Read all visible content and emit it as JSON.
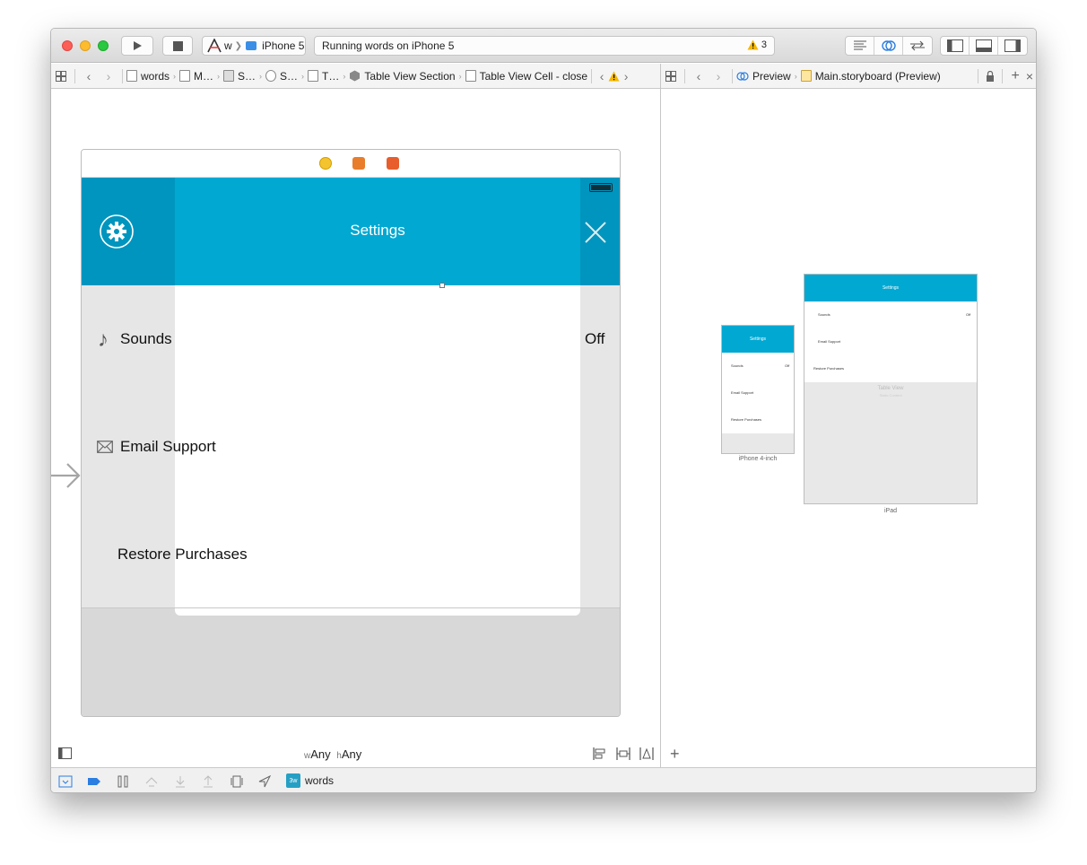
{
  "toolbar": {
    "scheme_target": "w",
    "device": "iPhone 5",
    "activity_text": "Running words on iPhone 5",
    "warning_count": "3"
  },
  "jumpbar_left": {
    "items": [
      "words",
      "M…",
      "S…",
      "S…",
      "T…",
      "Table View Section",
      "Table View Cell - close"
    ]
  },
  "jumpbar_right": {
    "mode": "Preview",
    "file": "Main.storyboard (Preview)"
  },
  "scene": {
    "nav_title": "Settings",
    "rows": {
      "sounds_label": "Sounds",
      "sounds_value": "Off",
      "email_label": "Email Support",
      "restore_label": "Restore Purchases"
    }
  },
  "editor_bottom": {
    "w_prefix": "w",
    "w_value": "Any",
    "h_prefix": "h",
    "h_value": "Any"
  },
  "preview": {
    "iphone_caption": "iPhone 4-inch",
    "ipad_caption": "iPad",
    "mini_title": "Settings",
    "mini_sounds": "Sounds",
    "mini_off": "Off",
    "mini_email": "Email Support",
    "mini_restore": "Restore Purchases",
    "table_view_label": "Table View",
    "table_view_sub": "Static Content"
  },
  "debug": {
    "target_name": "words",
    "app_icon_text": "3w"
  },
  "colors": {
    "nav_bar": "#00a8d2",
    "nav_bar_dark": "#0095be",
    "warning": "#f5b800"
  }
}
